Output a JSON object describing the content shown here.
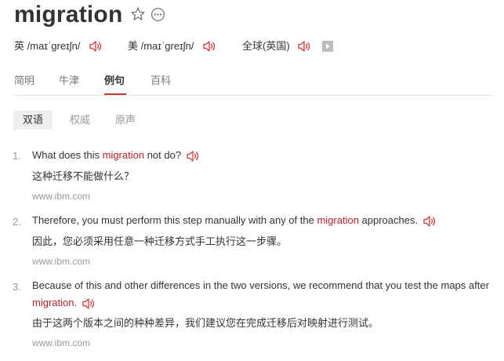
{
  "entry": {
    "word": "migration",
    "star_icon": "star-outline-icon",
    "more_icon": "more-circle-icon"
  },
  "phonetics": {
    "uk_label": "英",
    "uk_ipa": "/maɪˈɡreɪʃn/",
    "us_label": "美",
    "us_ipa": "/maɪˈɡreɪʃn/",
    "global_label": "全球(英国)",
    "speaker_icon": "speaker-icon",
    "speaker_color": "#d0383b",
    "play_icon": "play-arrow-icon"
  },
  "tabs": [
    {
      "label": "简明"
    },
    {
      "label": "牛津"
    },
    {
      "label": "例句"
    },
    {
      "label": "百科"
    }
  ],
  "subtabs": [
    {
      "label": "双语"
    },
    {
      "label": "权威"
    },
    {
      "label": "原声"
    }
  ],
  "examples": [
    {
      "num": "1.",
      "en_before": "What does this ",
      "en_keyword": "migration",
      "en_after": " not do?",
      "cn": "这种迁移不能做什么？",
      "source": "www.ibm.com"
    },
    {
      "num": "2.",
      "en_before": "Therefore, you must perform this step manually with any of the ",
      "en_keyword": "migration",
      "en_after": " approaches.",
      "cn": "因此，您必须采用任意一种迁移方式手工执行这一步骤。",
      "source": "www.ibm.com"
    },
    {
      "num": "3.",
      "en_before": "Because of this and other differences in the two versions, we recommend that you test the maps after ",
      "en_keyword": "migration",
      "en_after": ".",
      "cn": "由于这两个版本之间的种种差异，我们建议您在完成迁移后对映射进行测试。",
      "source": "www.ibm.com"
    }
  ],
  "colors": {
    "accent": "#b3212b",
    "muted": "#999999",
    "active_bg": "#eeeeee"
  }
}
